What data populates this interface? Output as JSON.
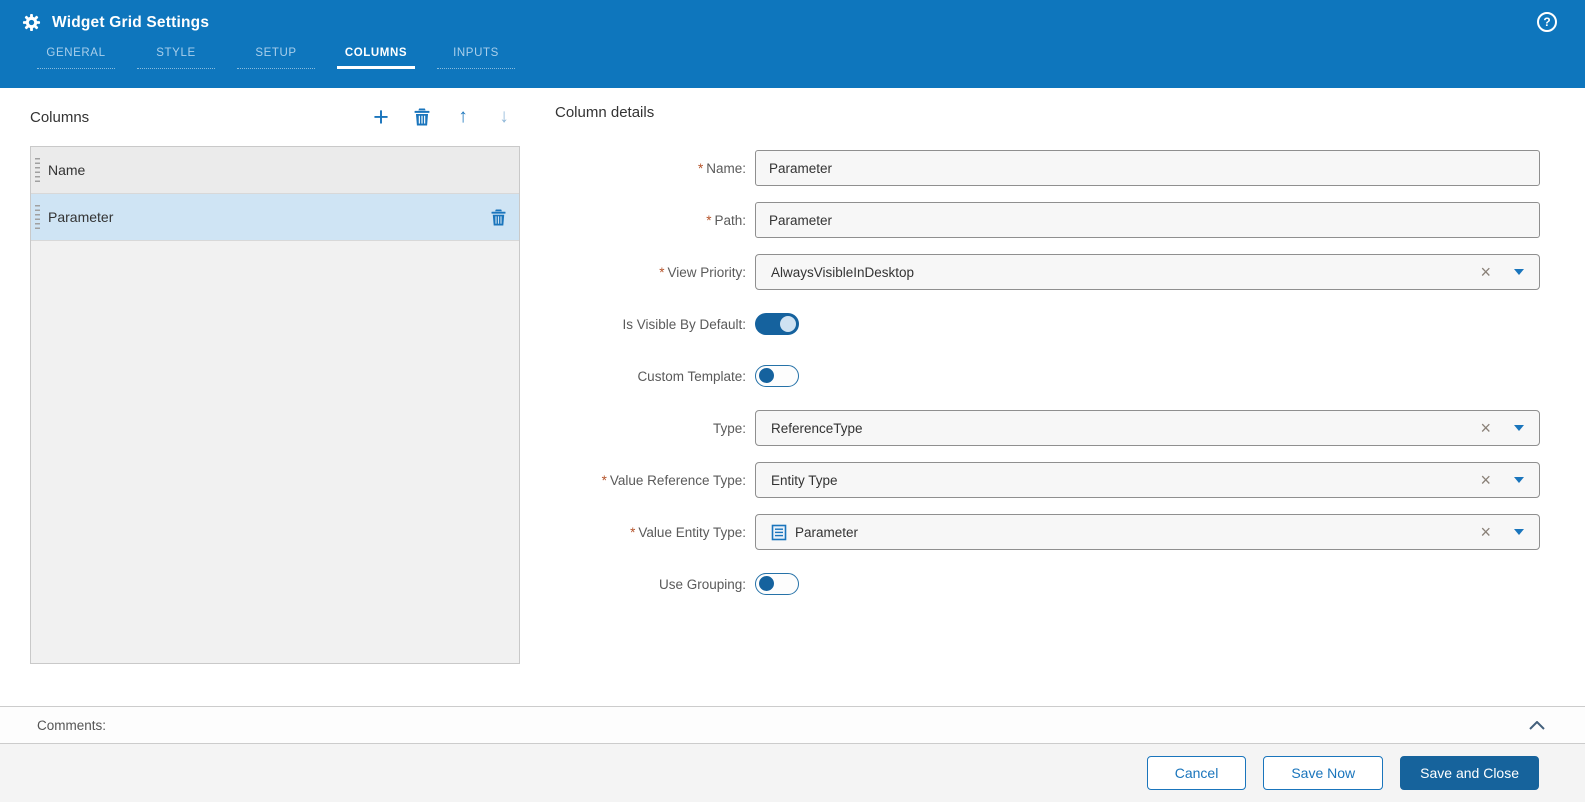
{
  "colors": {
    "header_blue": "#0e76bd",
    "accent_blue": "#1a75bc",
    "primary_button_blue": "#16639c",
    "toggle_on_blue": "#15629e",
    "selected_row_blue": "#cfe4f4",
    "required_asterisk": "#b5532a"
  },
  "header": {
    "title": "Widget Grid Settings",
    "icons": {
      "gear": "gear-icon",
      "help": "?"
    },
    "tabs": [
      {
        "id": "general",
        "label": "GENERAL",
        "active": false
      },
      {
        "id": "style",
        "label": "STYLE",
        "active": false
      },
      {
        "id": "setup",
        "label": "SETUP",
        "active": false
      },
      {
        "id": "columns",
        "label": "COLUMNS",
        "active": true
      },
      {
        "id": "inputs",
        "label": "INPUTS",
        "active": false
      }
    ]
  },
  "columns_panel": {
    "title": "Columns",
    "toolbar": {
      "add_glyph": "+",
      "delete_icon": "trash-icon",
      "move_up_glyph": "↑",
      "move_down_glyph": "↓"
    },
    "items": [
      {
        "label": "Name",
        "selected": false
      },
      {
        "label": "Parameter",
        "selected": true
      }
    ]
  },
  "details": {
    "title": "Column details",
    "required_marker": "*",
    "clear_glyph": "×",
    "name": {
      "label": "Name:",
      "required": true,
      "value": "Parameter"
    },
    "path": {
      "label": "Path:",
      "required": true,
      "value": "Parameter"
    },
    "view_priority": {
      "label": "View Priority:",
      "required": true,
      "value": "AlwaysVisibleInDesktop"
    },
    "is_visible_by_default": {
      "label": "Is Visible By Default:",
      "state": "on"
    },
    "custom_template": {
      "label": "Custom Template:",
      "state": "off"
    },
    "type": {
      "label": "Type:",
      "required": false,
      "value": "ReferenceType"
    },
    "value_reference_type": {
      "label": "Value Reference Type:",
      "required": true,
      "value": "Entity Type"
    },
    "value_entity_type": {
      "label": "Value Entity Type:",
      "required": true,
      "value": "Parameter",
      "icon": "entity-type-icon"
    },
    "use_grouping": {
      "label": "Use Grouping:",
      "state": "off"
    }
  },
  "comments": {
    "label": "Comments:"
  },
  "footer": {
    "cancel": "Cancel",
    "save_now": "Save Now",
    "save_and_close": "Save and Close"
  }
}
